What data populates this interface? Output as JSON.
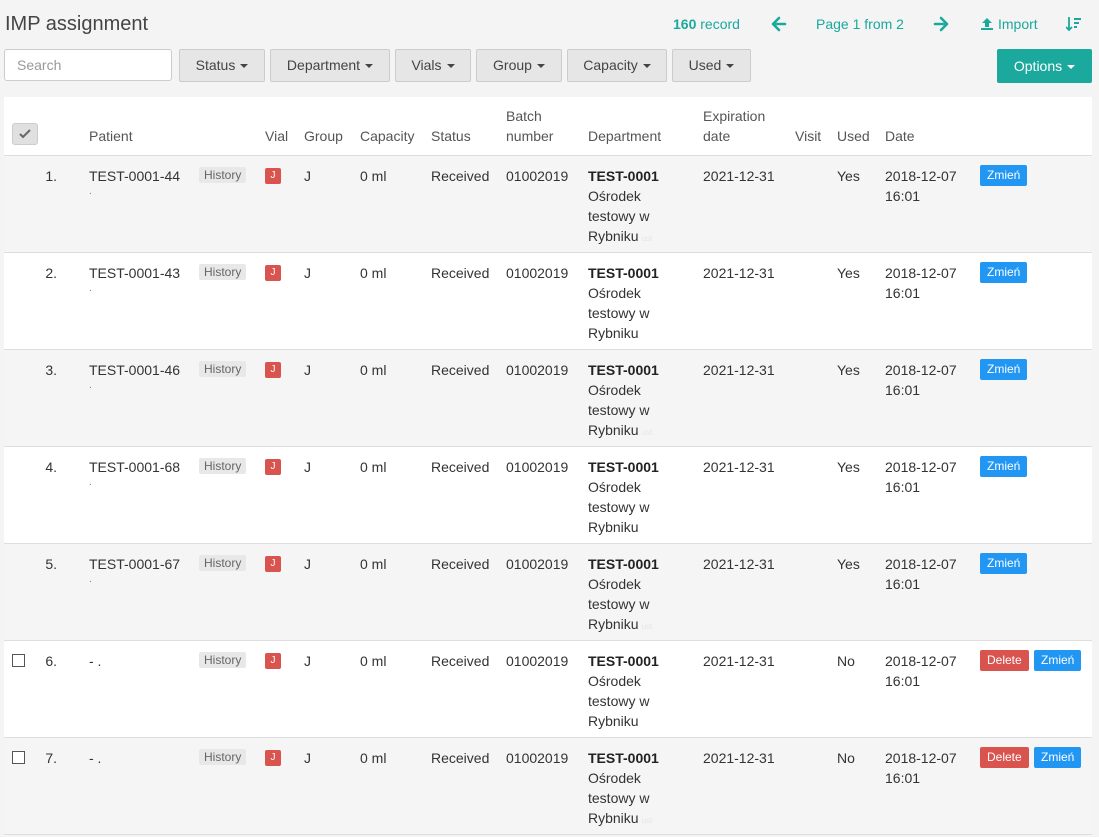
{
  "header": {
    "title": "IMP assignment",
    "record_count": "160",
    "record_label": "record",
    "page_info": "Page 1 from 2",
    "import_label": "Import"
  },
  "search": {
    "placeholder": "Search",
    "value": ""
  },
  "filters": [
    "Status",
    "Department",
    "Vials",
    "Group",
    "Capacity",
    "Used"
  ],
  "options_label": "Options",
  "columns": {
    "patient": "Patient",
    "vial": "Vial",
    "group": "Group",
    "capacity": "Capacity",
    "status": "Status",
    "batch_line1": "Batch",
    "batch_line2": "number",
    "department": "Department",
    "expiration_line1": "Expiration",
    "expiration_line2": "date",
    "visit": "Visit",
    "used": "Used",
    "date": "Date"
  },
  "colors": {
    "accent": "#1aa99c",
    "primary": "#2196f3",
    "danger": "#d9534f"
  },
  "rows": [
    {
      "num": "1.",
      "patient": "TEST-0001-44",
      "patient_sub": ".",
      "history": "History",
      "vial": "J",
      "group": "J",
      "capacity": "0 ml",
      "status": "Received",
      "batch": "01002019",
      "dept_code": "TEST-0001",
      "dept_name1": "Ośrodek",
      "dept_name2": "testowy w",
      "dept_name3": "Rybniku",
      "dept_tag": "ust",
      "expiration": "2021-12-31",
      "visit": "",
      "used": "Yes",
      "date1": "2018-12-07",
      "date2": "16:01",
      "edit": "Zmień",
      "delete": "",
      "checkbox": false
    },
    {
      "num": "2.",
      "patient": "TEST-0001-43",
      "patient_sub": ".",
      "history": "History",
      "vial": "J",
      "group": "J",
      "capacity": "0 ml",
      "status": "Received",
      "batch": "01002019",
      "dept_code": "TEST-0001",
      "dept_name1": "Ośrodek",
      "dept_name2": "testowy w",
      "dept_name3": "Rybniku",
      "dept_tag": "",
      "expiration": "2021-12-31",
      "visit": "",
      "used": "Yes",
      "date1": "2018-12-07",
      "date2": "16:01",
      "edit": "Zmień",
      "delete": "",
      "checkbox": false
    },
    {
      "num": "3.",
      "patient": "TEST-0001-46",
      "patient_sub": ".",
      "history": "History",
      "vial": "J",
      "group": "J",
      "capacity": "0 ml",
      "status": "Received",
      "batch": "01002019",
      "dept_code": "TEST-0001",
      "dept_name1": "Ośrodek",
      "dept_name2": "testowy w",
      "dept_name3": "Rybniku",
      "dept_tag": "ust",
      "expiration": "2021-12-31",
      "visit": "",
      "used": "Yes",
      "date1": "2018-12-07",
      "date2": "16:01",
      "edit": "Zmień",
      "delete": "",
      "checkbox": false
    },
    {
      "num": "4.",
      "patient": "TEST-0001-68",
      "patient_sub": ".",
      "history": "History",
      "vial": "J",
      "group": "J",
      "capacity": "0 ml",
      "status": "Received",
      "batch": "01002019",
      "dept_code": "TEST-0001",
      "dept_name1": "Ośrodek",
      "dept_name2": "testowy w",
      "dept_name3": "Rybniku",
      "dept_tag": "",
      "expiration": "2021-12-31",
      "visit": "",
      "used": "Yes",
      "date1": "2018-12-07",
      "date2": "16:01",
      "edit": "Zmień",
      "delete": "",
      "checkbox": false
    },
    {
      "num": "5.",
      "patient": "TEST-0001-67",
      "patient_sub": ".",
      "history": "History",
      "vial": "J",
      "group": "J",
      "capacity": "0 ml",
      "status": "Received",
      "batch": "01002019",
      "dept_code": "TEST-0001",
      "dept_name1": "Ośrodek",
      "dept_name2": "testowy w",
      "dept_name3": "Rybniku",
      "dept_tag": "ust",
      "expiration": "2021-12-31",
      "visit": "",
      "used": "Yes",
      "date1": "2018-12-07",
      "date2": "16:01",
      "edit": "Zmień",
      "delete": "",
      "checkbox": false
    },
    {
      "num": "6.",
      "patient": "- .",
      "patient_sub": "",
      "history": "History",
      "vial": "J",
      "group": "J",
      "capacity": "0 ml",
      "status": "Received",
      "batch": "01002019",
      "dept_code": "TEST-0001",
      "dept_name1": "Ośrodek",
      "dept_name2": "testowy w",
      "dept_name3": "Rybniku",
      "dept_tag": "",
      "expiration": "2021-12-31",
      "visit": "",
      "used": "No",
      "date1": "2018-12-07",
      "date2": "16:01",
      "edit": "Zmień",
      "delete": "Delete",
      "checkbox": true
    },
    {
      "num": "7.",
      "patient": "- .",
      "patient_sub": "",
      "history": "History",
      "vial": "J",
      "group": "J",
      "capacity": "0 ml",
      "status": "Received",
      "batch": "01002019",
      "dept_code": "TEST-0001",
      "dept_name1": "Ośrodek",
      "dept_name2": "testowy w",
      "dept_name3": "Rybniku",
      "dept_tag": "ust",
      "expiration": "2021-12-31",
      "visit": "",
      "used": "No",
      "date1": "2018-12-07",
      "date2": "16:01",
      "edit": "Zmień",
      "delete": "Delete",
      "checkbox": true
    }
  ]
}
